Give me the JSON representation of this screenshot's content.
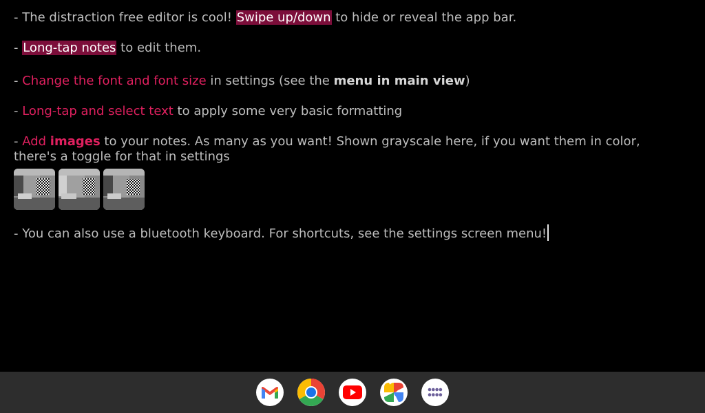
{
  "editor": {
    "lines": [
      {
        "pre": "- The distraction free editor is cool! ",
        "hl": "Swipe up/down",
        "post": " to hide or reveal the app bar."
      },
      {
        "pre": "- ",
        "hl": "Long-tap notes",
        "post": " to edit them."
      },
      {
        "pre": "- ",
        "pink": "Change the font and font size",
        "mid": " in settings (see the ",
        "bold": "menu in main view",
        "post": ")"
      },
      {
        "pre": "- ",
        "pink": "Long-tap and select text",
        "post": " to apply some very basic formatting"
      },
      {
        "pre": "- ",
        "pink": "Add ",
        "pinkbold": "images",
        "post": " to your notes. As many as you want! Shown grayscale here, if you want them in color, there's a toggle for that in settings"
      },
      {
        "text": "- You can also use a bluetooth keyboard. For shortcuts, see the settings screen menu!"
      }
    ],
    "image_count": 3
  },
  "shelf": {
    "apps": [
      {
        "name": "Gmail",
        "icon": "gmail-icon"
      },
      {
        "name": "Chrome",
        "icon": "chrome-icon"
      },
      {
        "name": "YouTube",
        "icon": "youtube-icon"
      },
      {
        "name": "Photos",
        "icon": "photos-icon"
      },
      {
        "name": "Launcher",
        "icon": "app-launcher-icon"
      }
    ]
  },
  "colors": {
    "background": "#000000",
    "text": "#bdbdbd",
    "accent": "#e0205f",
    "highlight": "#7c0e3a",
    "shelf": "#2d2d2d"
  }
}
